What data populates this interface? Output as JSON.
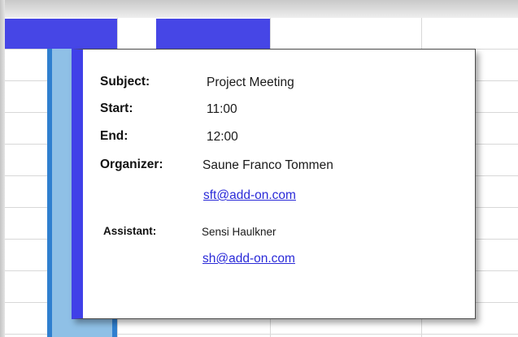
{
  "tooltip": {
    "subject_label": "Subject:",
    "subject_value": "Project Meeting",
    "start_label": "Start:",
    "start_value": "11:00",
    "end_label": "End:",
    "end_value": "12:00",
    "organizer_label": "Organizer:",
    "organizer_name": "Saune Franco Tommen",
    "organizer_email": "sft@add-on.com",
    "assistant_label": "Assistant:",
    "assistant_name": "Sensi Haulkner",
    "assistant_email": "sh@add-on.com"
  },
  "colors": {
    "header_block": "#4646e6",
    "tooltip_accent": "#4040e8",
    "appointment_fill": "#8fc0e6",
    "appointment_border": "#2f7fcf",
    "link": "#2a2ad8"
  }
}
